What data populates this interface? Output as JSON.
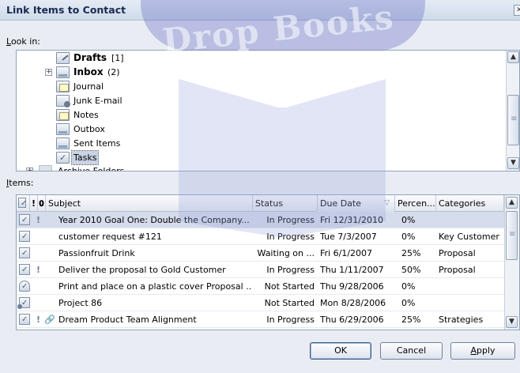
{
  "window": {
    "title": "Link Items to Contact",
    "close_glyph": "✕"
  },
  "look_in": {
    "prefix": "L",
    "rest": "ook in:"
  },
  "folders": [
    {
      "name": "Drafts",
      "count": "[1]",
      "bold": true,
      "icon": "drafts-folder-icon"
    },
    {
      "name": "Inbox",
      "count": "(2)",
      "bold": true,
      "icon": "inbox-folder-icon",
      "expandable": true
    },
    {
      "name": "Journal",
      "count": "",
      "bold": false,
      "icon": "journal-icon"
    },
    {
      "name": "Junk E-mail",
      "count": "",
      "bold": false,
      "icon": "junk-mail-folder-icon"
    },
    {
      "name": "Notes",
      "count": "",
      "bold": false,
      "icon": "notes-icon"
    },
    {
      "name": "Outbox",
      "count": "",
      "bold": false,
      "icon": "outbox-folder-icon"
    },
    {
      "name": "Sent Items",
      "count": "",
      "bold": false,
      "icon": "sent-items-folder-icon"
    },
    {
      "name": "Tasks",
      "count": "",
      "bold": false,
      "icon": "tasks-icon",
      "selected": true
    },
    {
      "name": "Archive Folders",
      "count": "",
      "bold": false,
      "icon": "archive-folder-icon",
      "expandable": true
    }
  ],
  "items_label": {
    "prefix": "I",
    "rest": "tems:"
  },
  "columns": {
    "subject": "Subject",
    "status": "Status",
    "due_date": "Due Date",
    "percent": "Percen...",
    "categories": "Categories",
    "importance_glyph": "!",
    "attachment_glyph": "𝟎"
  },
  "rows": [
    {
      "subject": "Year 2010 Goal One: Double the Company...",
      "status": "In Progress",
      "due": "Fri 12/31/2010",
      "percent": "0%",
      "categories": "",
      "important": "!",
      "attachment": ""
    },
    {
      "subject": "customer request #121",
      "status": "In Progress",
      "due": "Tue 7/3/2007",
      "percent": "0%",
      "categories": "Key Customer",
      "important": "",
      "attachment": ""
    },
    {
      "subject": "Passionfruit Drink",
      "status": "Waiting on ...",
      "due": "Fri 6/1/2007",
      "percent": "25%",
      "categories": "Proposal",
      "important": "",
      "attachment": ""
    },
    {
      "subject": "Deliver the proposal to Gold Customer",
      "status": "In Progress",
      "due": "Thu 1/11/2007",
      "percent": "50%",
      "categories": "Proposal",
      "important": "!",
      "attachment": ""
    },
    {
      "subject": "Print and place on a plastic cover Proposal ...",
      "status": "Not Started",
      "due": "Thu 9/28/2006",
      "percent": "0%",
      "categories": "",
      "important": "",
      "attachment": ""
    },
    {
      "subject": "Project 86",
      "status": "Not Started",
      "due": "Mon 8/28/2006",
      "percent": "0%",
      "categories": "",
      "important": "",
      "attachment": ""
    },
    {
      "subject": "Dream Product Team Alignment",
      "status": "In Progress",
      "due": "Thu 6/29/2006",
      "percent": "25%",
      "categories": "Strategies",
      "important": "!",
      "attachment": "🔗"
    }
  ],
  "buttons": {
    "ok": "OK",
    "cancel": "Cancel",
    "apply_prefix": "A",
    "apply_rest": "pply"
  },
  "scroll_glyphs": {
    "up": "▲",
    "down": "▼",
    "expand": "+"
  },
  "watermark": {
    "text": "Drop Books"
  },
  "colors": {
    "title_text": "#1a2a50",
    "selection": "#d5dceb",
    "watermark_band": "#465ac8"
  }
}
